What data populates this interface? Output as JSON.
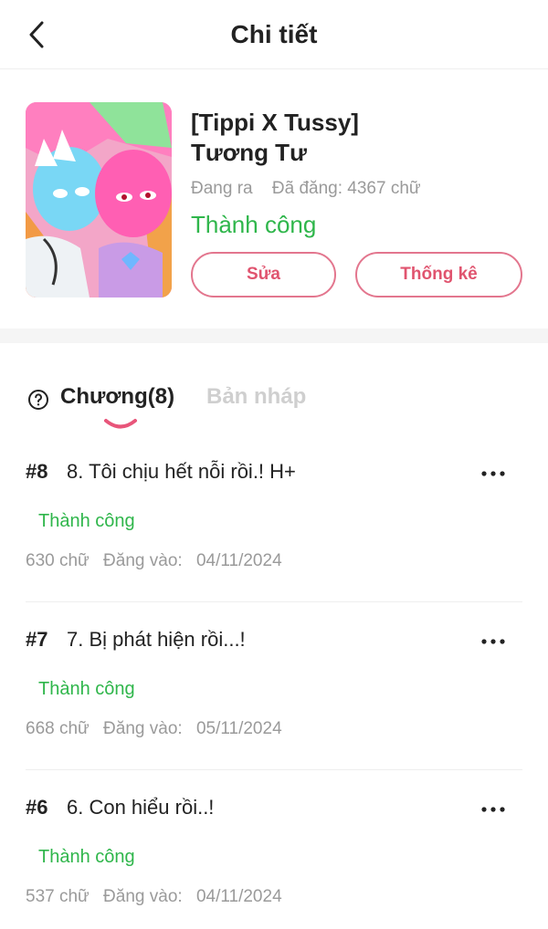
{
  "header": {
    "title": "Chi tiết",
    "back_icon": "chevron-left-icon"
  },
  "book": {
    "title_line1": "[Tippi X Tussy]",
    "title_line2": "Tương Tư",
    "state": "Đang ra",
    "posted": "Đã đăng: 4367 chữ",
    "status": "Thành công",
    "edit_label": "Sửa",
    "stats_label": "Thống kê"
  },
  "tabs": {
    "chapters_label": "Chương(8)",
    "drafts_label": "Bản nháp"
  },
  "chapters": [
    {
      "num": "#8",
      "title": "8. Tôi chịu hết nỗi rồi.! H+",
      "status": "Thành công",
      "words": "630 chữ",
      "posted_label": "Đăng vào:",
      "date": "04/11/2024"
    },
    {
      "num": "#7",
      "title": "7. Bị phát hiện rồi...!",
      "status": "Thành công",
      "words": "668 chữ",
      "posted_label": "Đăng vào:",
      "date": "05/11/2024"
    },
    {
      "num": "#6",
      "title": "6. Con hiểu rồi..!",
      "status": "Thành công",
      "words": "537 chữ",
      "posted_label": "Đăng vào:",
      "date": "04/11/2024"
    }
  ],
  "colors": {
    "accent": "#e3768e",
    "success": "#2fb64b",
    "muted": "#9a9a9a"
  }
}
